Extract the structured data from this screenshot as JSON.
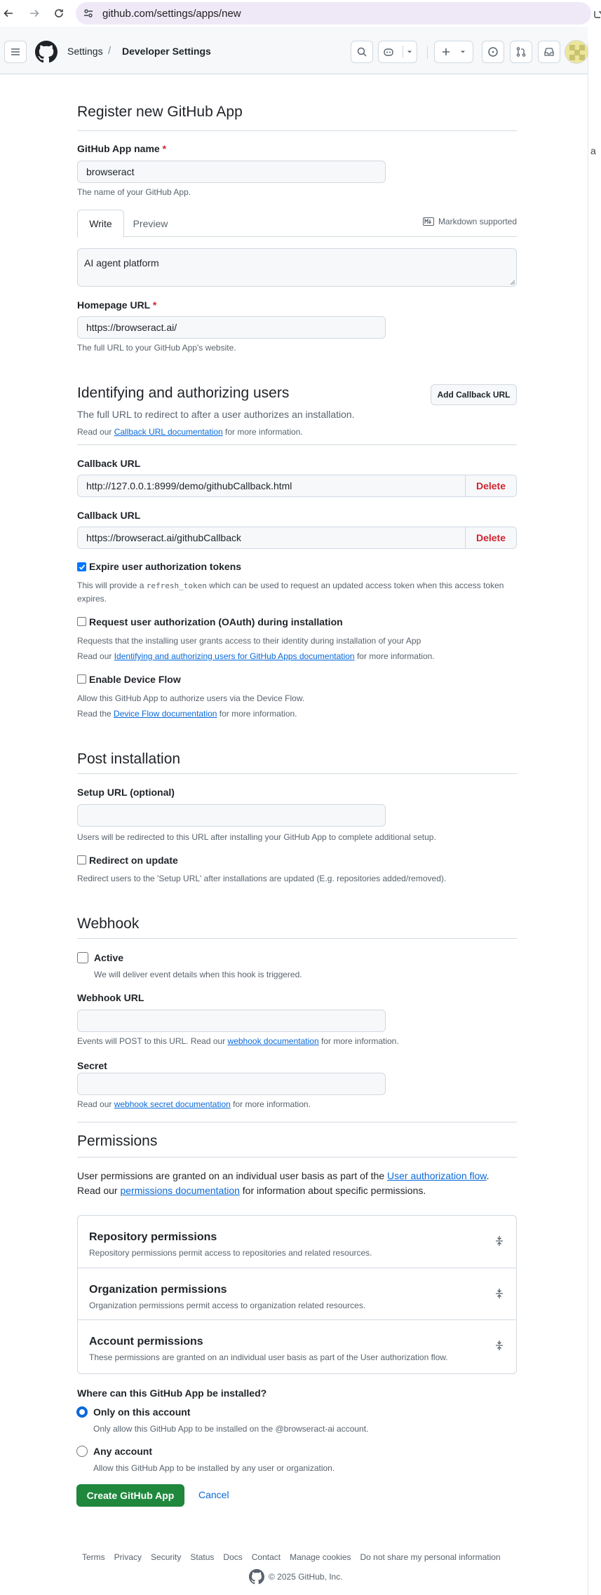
{
  "browser": {
    "url": "github.com/settings/apps/new",
    "side_letter": "a"
  },
  "header": {
    "crumb_settings": "Settings",
    "crumb_separator": "/",
    "crumb_developer": "Developer Settings"
  },
  "form": {
    "title": "Register new GitHub App",
    "app_name_label": "GitHub App name",
    "required_mark": "*",
    "app_name_value": "browseract",
    "app_name_note": "The name of your GitHub App.",
    "tab_write": "Write",
    "tab_preview": "Preview",
    "markdown_supported": "Markdown supported",
    "description_value": "AI agent platform",
    "homepage_label": "Homepage URL",
    "homepage_value": "https://browseract.ai/",
    "homepage_note": "The full URL to your GitHub App's website."
  },
  "identifying": {
    "title": "Identifying and authorizing users",
    "add_callback_button": "Add Callback URL",
    "intro": "The full URL to redirect to after a user authorizes an installation.",
    "read_prefix": "Read our",
    "doc_link": "Callback URL documentation",
    "read_suffix": "for more information.",
    "callbacks": [
      {
        "label": "Callback URL",
        "value": "http://127.0.0.1:8999/demo/githubCallback.html",
        "delete": "Delete"
      },
      {
        "label": "Callback URL",
        "value": "https://browseract.ai/githubCallback",
        "delete": "Delete"
      }
    ],
    "expire_label": "Expire user authorization tokens",
    "expire_checked": true,
    "expire_note_pre": "This will provide a",
    "expire_note_code": "refresh_token",
    "expire_note_post": "which can be used to request an updated access token when this access token",
    "expire_note_line2": "expires.",
    "oauth_label": "Request user authorization (OAuth) during installation",
    "oauth_checked": false,
    "oauth_note": "Requests that the installing user grants access to their identity during installation of your App",
    "oauth_read_prefix": "Read our",
    "oauth_doc_link": "Identifying and authorizing users for GitHub Apps documentation",
    "oauth_read_suffix": "for more information.",
    "device_label": "Enable Device Flow",
    "device_checked": false,
    "device_note": "Allow this GitHub App to authorize users via the Device Flow.",
    "device_read_prefix": "Read the",
    "device_doc_link": "Device Flow documentation",
    "device_read_suffix": "for more information."
  },
  "post_install": {
    "title": "Post installation",
    "setup_label": "Setup URL (optional)",
    "setup_value": "",
    "setup_note": "Users will be redirected to this URL after installing your GitHub App to complete additional setup.",
    "redirect_label": "Redirect on update",
    "redirect_checked": false,
    "redirect_note": "Redirect users to the 'Setup URL' after installations are updated (E.g. repositories added/removed)."
  },
  "webhook": {
    "title": "Webhook",
    "active_label": "Active",
    "active_checked": false,
    "active_note": "We will deliver event details when this hook is triggered.",
    "url_label": "Webhook URL",
    "url_value": "",
    "url_note_prefix": "Events will POST to this URL. Read our",
    "url_doc_link": "webhook documentation",
    "url_note_suffix": "for more information.",
    "secret_label": "Secret",
    "secret_value": "",
    "secret_note_prefix": "Read our",
    "secret_doc_link": "webhook secret documentation",
    "secret_note_suffix": "for more information."
  },
  "permissions": {
    "title": "Permissions",
    "line1_prefix": "User permissions are granted on an individual user basis as part of the",
    "line1_link": "User authorization flow",
    "line1_suffix": ".",
    "line2_prefix": "Read our",
    "line2_link": "permissions documentation",
    "line2_suffix": "for information about specific permissions.",
    "groups": [
      {
        "title": "Repository permissions",
        "desc": "Repository permissions permit access to repositories and related resources."
      },
      {
        "title": "Organization permissions",
        "desc": "Organization permissions permit access to organization related resources."
      },
      {
        "title": "Account permissions",
        "desc": "These permissions are granted on an individual user basis as part of the User authorization flow."
      }
    ]
  },
  "install": {
    "question": "Where can this GitHub App be installed?",
    "options": [
      {
        "label": "Only on this account",
        "desc": "Only allow this GitHub App to be installed on the @browseract-ai account.",
        "selected": true
      },
      {
        "label": "Any account",
        "desc": "Allow this GitHub App to be installed by any user or organization.",
        "selected": false
      }
    ]
  },
  "actions": {
    "create": "Create GitHub App",
    "cancel": "Cancel"
  },
  "footer": {
    "links": [
      "Terms",
      "Privacy",
      "Security",
      "Status",
      "Docs",
      "Contact",
      "Manage cookies",
      "Do not share my personal information"
    ],
    "copyright": "© 2025 GitHub, Inc."
  },
  "colors": {
    "primary_button": "#1f883d",
    "link": "#0969da",
    "danger": "#d1242f",
    "checkbox_on": "#0075ff"
  }
}
